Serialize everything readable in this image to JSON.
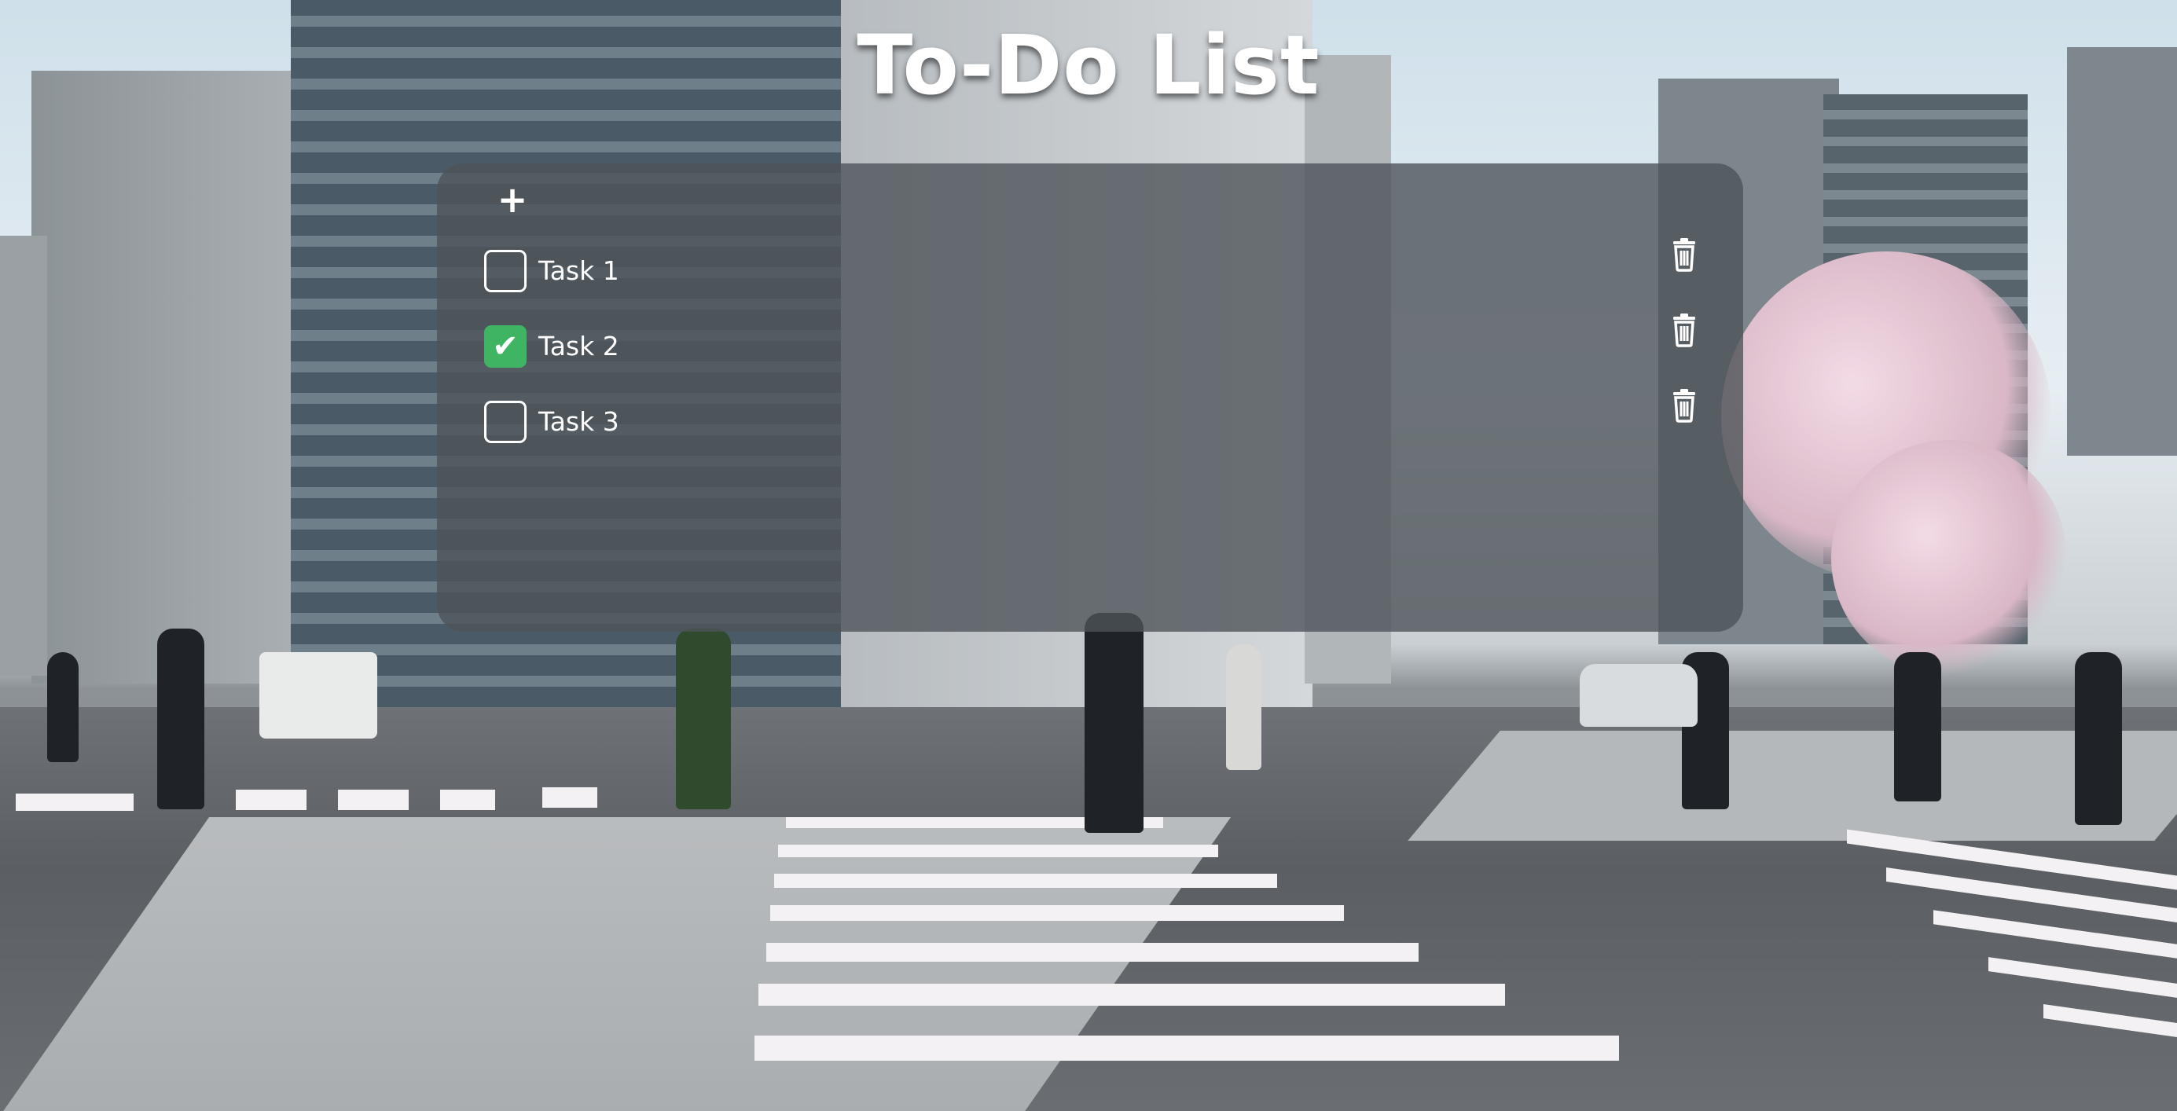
{
  "app": {
    "title": "To-Do List"
  },
  "toolbar": {
    "add_label": "+"
  },
  "tasks": [
    {
      "label": "Task 1",
      "checked": false,
      "check_glyph": ""
    },
    {
      "label": "Task 2",
      "checked": true,
      "check_glyph": "✔"
    },
    {
      "label": "Task 3",
      "checked": false,
      "check_glyph": ""
    }
  ],
  "icons": {
    "add": "plus-icon",
    "delete": "trash-icon",
    "check": "checkmark-icon"
  },
  "colors": {
    "panel_bg": "#4e5459",
    "checked_bg": "#3fb463",
    "text": "#ffffff"
  }
}
